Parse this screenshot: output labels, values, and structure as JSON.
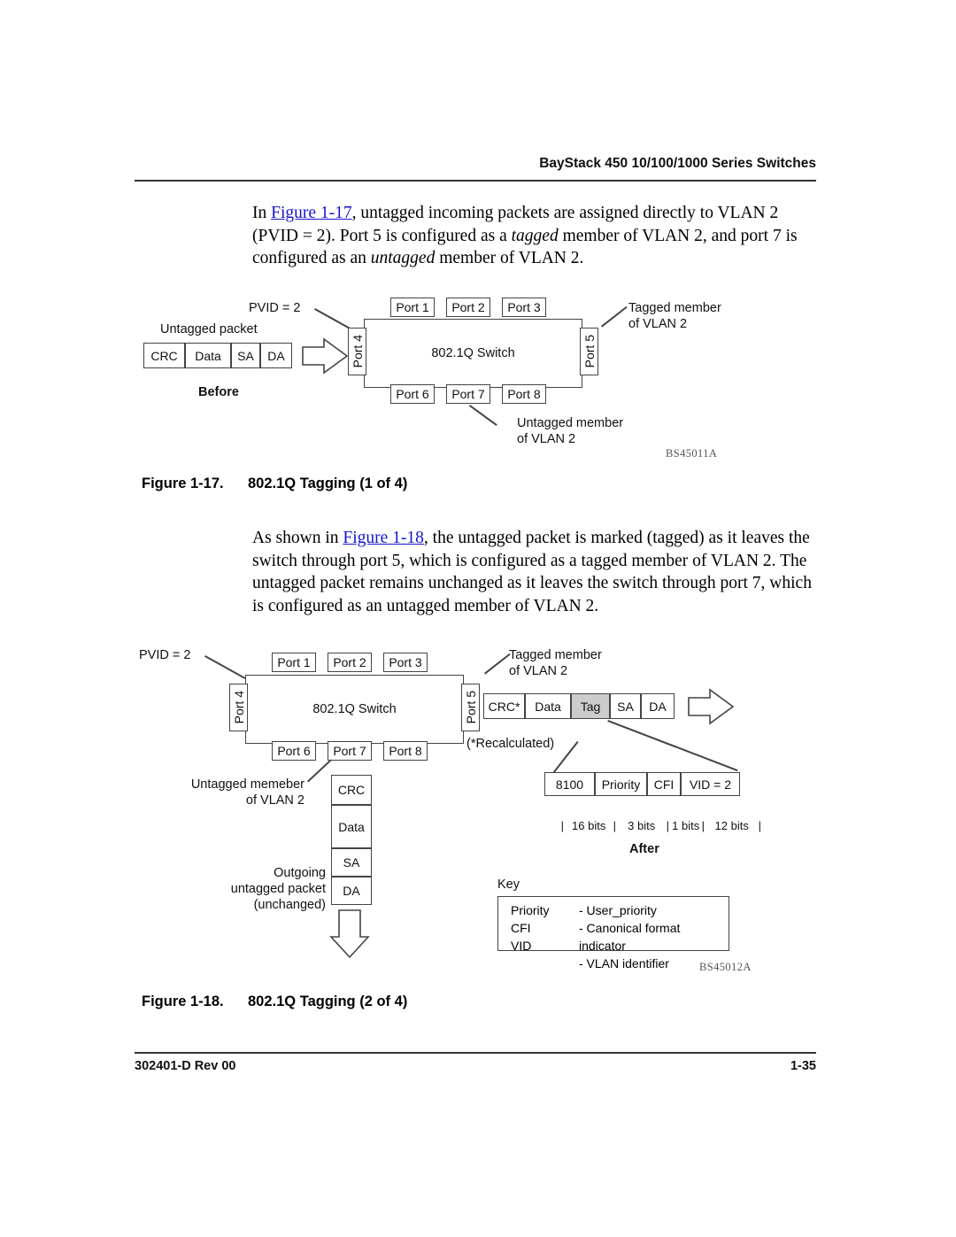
{
  "header": {
    "title": "BayStack 450 10/100/1000 Series Switches"
  },
  "footer": {
    "doc_id": "302401-D Rev 00",
    "page_number": "1-35"
  },
  "paragraph1": {
    "part1": "In ",
    "xref": "Figure 1-17",
    "part2": ", untagged incoming packets are assigned directly to VLAN 2 (PVID = 2). Port 5 is configured as a ",
    "italic1": "tagged",
    "part3": " member of VLAN 2, and port 7 is configured as an ",
    "italic2": "untagged",
    "part4": " member of VLAN 2."
  },
  "paragraph2": {
    "part1": "As shown in ",
    "xref": "Figure 1-18",
    "part2": ", the untagged packet is marked (tagged) as it leaves the switch through port 5, which is configured as a tagged member of VLAN 2. The untagged packet remains unchanged as it leaves the switch through port 7, which is configured as an untagged member of VLAN 2."
  },
  "figure17": {
    "caption_number": "Figure 1-17.",
    "caption_text": "802.1Q Tagging (1 of 4)",
    "id_code": "BS45011A",
    "switch_label": "802.1Q Switch",
    "pvid_label": "PVID = 2",
    "packet_title": "Untagged packet",
    "state_label": "Before",
    "packet_cells": [
      "CRC",
      "Data",
      "SA",
      "DA"
    ],
    "ports_top": [
      "Port 1",
      "Port 2",
      "Port 3"
    ],
    "ports_bottom": [
      "Port 6",
      "Port 7",
      "Port 8"
    ],
    "port_left": "Port 4",
    "port_right": "Port 5",
    "callout_tagged": "Tagged member\nof VLAN 2",
    "callout_untagged": "Untagged member\nof VLAN 2"
  },
  "figure18": {
    "caption_number": "Figure 1-18.",
    "caption_text": "802.1Q Tagging (2 of 4)",
    "id_code": "BS45012A",
    "switch_label": "802.1Q Switch",
    "pvid_label": "PVID = 2",
    "state_label": "After",
    "ports_top": [
      "Port 1",
      "Port 2",
      "Port 3"
    ],
    "ports_bottom": [
      "Port 6",
      "Port 7",
      "Port 8"
    ],
    "port_left": "Port 4",
    "port_right": "Port 5",
    "callout_tagged": "Tagged member\nof VLAN 2",
    "callout_untagged": "Untagged memeber\nof VLAN 2",
    "recalculated_note": "(*Recalculated)",
    "outgoing_note": "Outgoing\nuntagged packet\n(unchanged)",
    "tagged_packet_cells": [
      "CRC*",
      "Data",
      "Tag",
      "SA",
      "DA"
    ],
    "tag_highlight_color": "#cccccc",
    "outgoing_packet_cells": [
      "CRC",
      "Data",
      "SA",
      "DA"
    ],
    "tag_fields": [
      "8100",
      "Priority",
      "CFI",
      "VID = 2"
    ],
    "tag_field_bits": [
      "16 bits",
      "3 bits",
      "1 bits",
      "12 bits"
    ],
    "key": {
      "title": "Key",
      "rows": [
        {
          "term": "Priority",
          "definition": "- User_priority"
        },
        {
          "term": "CFI",
          "definition": "- Canonical format indicator"
        },
        {
          "term": "VID",
          "definition": "- VLAN identifier"
        }
      ]
    }
  }
}
